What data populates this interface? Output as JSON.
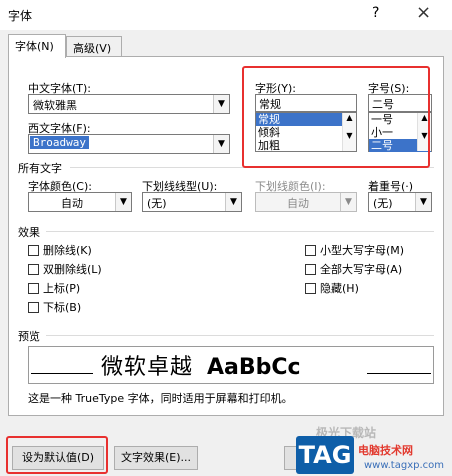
{
  "window": {
    "title": "字体",
    "help": "?",
    "close": "×"
  },
  "tabs": [
    {
      "label": "字体(N)"
    },
    {
      "label": "高级(V)"
    }
  ],
  "chinese_font": {
    "label": "中文字体(T):",
    "value": "微软雅黑"
  },
  "western_font": {
    "label": "西文字体(F):",
    "value": "Broadway"
  },
  "style": {
    "label": "字形(Y):",
    "value": "常规",
    "options": [
      "常规",
      "倾斜",
      "加粗"
    ],
    "selected_index": 0
  },
  "size": {
    "label": "字号(S):",
    "value": "二号",
    "options": [
      "一号",
      "小一",
      "二号"
    ],
    "selected_index": 2
  },
  "all_text": {
    "heading": "所有文字"
  },
  "font_color": {
    "label": "字体颜色(C):",
    "value": "自动"
  },
  "underline_type": {
    "label": "下划线线型(U):",
    "value": "(无)"
  },
  "underline_color": {
    "label": "下划线颜色(I):",
    "value": "自动"
  },
  "emphasis": {
    "label": "着重号(·)",
    "value": "(无)"
  },
  "effects": {
    "heading": "效果",
    "left": [
      "删除线(K)",
      "双删除线(L)",
      "上标(P)",
      "下标(B)"
    ],
    "right": [
      "小型大写字母(M)",
      "全部大写字母(A)",
      "隐藏(H)"
    ]
  },
  "preview": {
    "heading": "预览",
    "sample_cn": "微软卓越",
    "sample_en": "AaBbCc",
    "note": "这是一种 TrueType 字体，同时适用于屏幕和打印机。"
  },
  "buttons": {
    "set_default": "设为默认值(D)",
    "text_effects": "文字效果(E)..."
  },
  "watermark": {
    "line1": "极光下载站",
    "tag": "TAG",
    "line2": "电脑技术网",
    "line3": "www.tagxp.com"
  },
  "colors": {
    "highlight": "#e8302f",
    "selection": "#3c73c9"
  }
}
